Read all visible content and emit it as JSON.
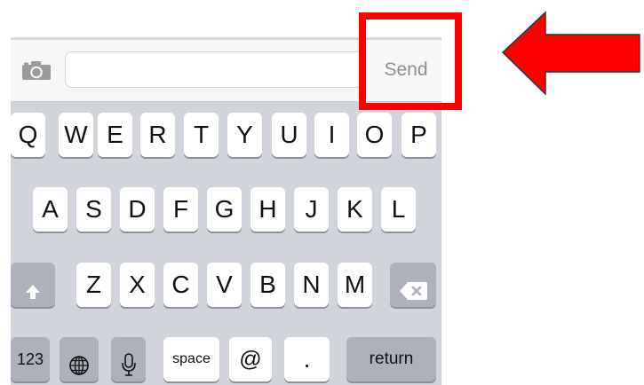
{
  "compose": {
    "camera_icon": "camera-icon",
    "input_value": "",
    "send_label": "Send"
  },
  "keyboard": {
    "row1": [
      "Q",
      "W",
      "E",
      "R",
      "T",
      "Y",
      "U",
      "I",
      "O",
      "P"
    ],
    "row2": [
      "A",
      "S",
      "D",
      "F",
      "G",
      "H",
      "J",
      "K",
      "L"
    ],
    "row3": [
      "Z",
      "X",
      "C",
      "V",
      "B",
      "N",
      "M"
    ],
    "shift_icon": "shift-icon",
    "backspace_icon": "backspace-icon",
    "numbers_label": "123",
    "globe_icon": "globe-icon",
    "mic_icon": "microphone-icon",
    "space_label": "space",
    "at_label": "@",
    "period_label": ".",
    "return_label": "return"
  },
  "annotation": {
    "color": "#ff0000",
    "target": "send-button",
    "arrow_direction": "left"
  }
}
